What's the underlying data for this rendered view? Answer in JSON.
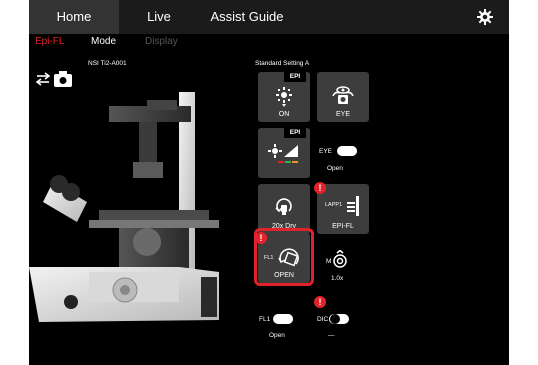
{
  "topnav": {
    "tabs": [
      {
        "label": "Home",
        "active": true
      },
      {
        "label": "Live",
        "active": false
      },
      {
        "label": "Assist Guide",
        "active": false
      }
    ],
    "settings_icon": "gear-icon"
  },
  "subnav": {
    "items": [
      {
        "label": "Epi-FL",
        "state": "active",
        "color": "#e3232c"
      },
      {
        "label": "Mode",
        "state": "enabled"
      },
      {
        "label": "Display",
        "state": "disabled"
      }
    ]
  },
  "left_panel": {
    "model_label": "NSI Ti2-A001",
    "swap_camera_icon": "swap-camera-icon"
  },
  "right_panel": {
    "setting_label": "Standard Setting A",
    "buttons": {
      "epi_shutter": {
        "badge": "EPI",
        "label": "ON",
        "icon": "light-source-icon"
      },
      "eyepiece": {
        "label": "EYE",
        "icon": "eye-camera-icon"
      },
      "epi_intensity": {
        "badge": "EPI",
        "icon": "intensity-icon"
      },
      "objective": {
        "label": "20x Dry",
        "icon": "objective-rotate-icon"
      },
      "lightpath": {
        "label": "EPI-FL",
        "prefix": "LAPP1",
        "icon": "lightpath-icon",
        "alert": "!"
      },
      "filter": {
        "label": "OPEN",
        "prefix": "FL1",
        "icon": "filter-turret-icon",
        "alert": "!"
      }
    },
    "eye_toggle": {
      "prefix": "EYE",
      "state": "Open"
    },
    "mag": {
      "prefix": "M",
      "value": "1.0x"
    },
    "fl1_toggle": {
      "prefix": "FL1",
      "state": "Open"
    },
    "dic_toggle": {
      "prefix": "DIC",
      "state": "—",
      "alert": "!"
    }
  },
  "colors": {
    "accent": "#e3232c",
    "button_bg": "#3d3d3d",
    "background": "#000000"
  }
}
